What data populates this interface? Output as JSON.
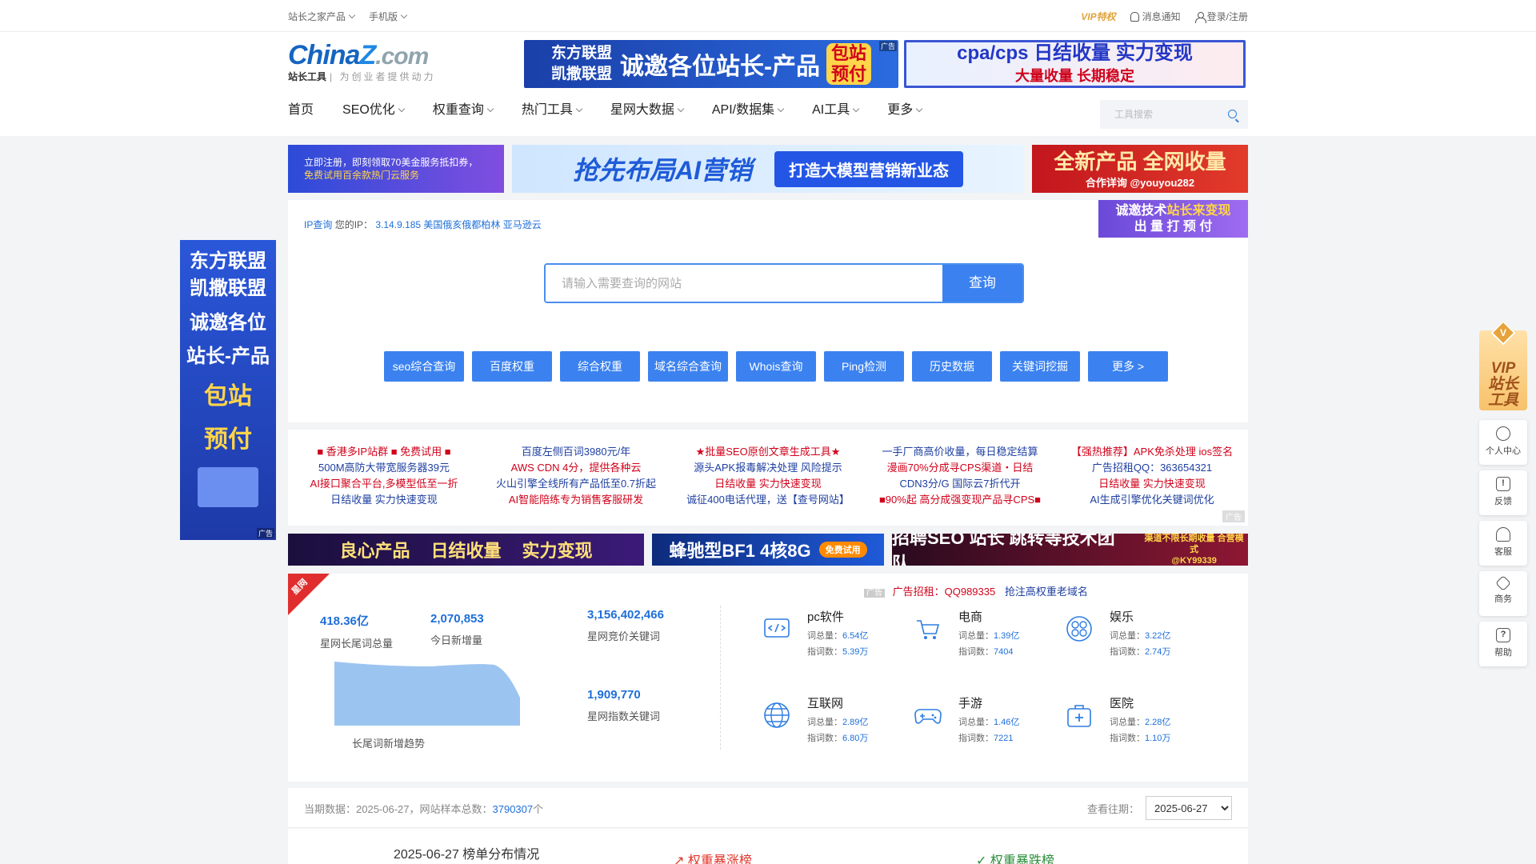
{
  "topbar": {
    "product_menu": "站长之家产品",
    "mobile": "手机版",
    "vip": "VIP特权",
    "notify": "消息通知",
    "login": "登录/注册"
  },
  "logo": {
    "brand_a": "China",
    "brand_z": "Z",
    "brand_com": ".com",
    "sub": "站长工具",
    "slogan": "| 为创业者提供动力"
  },
  "header_ads": {
    "ad1_small1": "东方联盟",
    "ad1_small2": "凯撒联盟",
    "ad1_big": "诚邀各位站长-产品",
    "ad1_tag1": "包站",
    "ad1_tag2": "预付",
    "ad2_l1": "cpa/cps 日结收量 实力变现",
    "ad2_l2": "大量收量 长期稳定",
    "ad_tag": "广告"
  },
  "nav": {
    "items": [
      "首页",
      "SEO优化",
      "权重查询",
      "热门工具",
      "星网大数据",
      "API/数据集",
      "AI工具",
      "更多"
    ],
    "search_placeholder": "工具搜索"
  },
  "banners2": {
    "a_l1": "立即注册，即刻领取70美金服务抵扣券，",
    "a_l2": "免费试用百余款热门云服务",
    "b_title": "抢先布局AI营销",
    "b_pill": "打造大模型营销新业态",
    "c_title": "全新产品 全网收量",
    "c_sub": "合作详询 @youyou282"
  },
  "ipinfo": {
    "label": "IP查询",
    "your_ip": "您的IP：",
    "value": "3.14.9.185 美国俄亥俄都柏林 亚马逊云"
  },
  "panel_ad": {
    "l1a": "诚邀技术",
    "l1b": "站长来变现",
    "l2": "出 量 打 预 付"
  },
  "main_search": {
    "placeholder": "请输入需要查询的网站",
    "button": "查询"
  },
  "quick_links": [
    "seo综合查询",
    "百度权重",
    "综合权重",
    "域名综合查询",
    "Whois查询",
    "Ping检测",
    "历史数据",
    "关键词挖掘",
    "更多 >"
  ],
  "text_ads": [
    [
      "■ 香港多IP站群 ■ 免费试用 ■",
      "500M高防大带宽服务器39元",
      "AI接口聚合平台,多模型低至一折",
      "日结收量 实力快速变现"
    ],
    [
      "百度左侧百词3980元/年",
      "AWS CDN 4分，提供各种云",
      "火山引擎全线所有产品低至0.7折起",
      "AI智能陪练专为销售客服研发"
    ],
    [
      "★批量SEO原创文章生成工具★",
      "源头APK报毒解决处理 风险提示",
      "日结收量 实力快速变现",
      "诚征400电话代理，送【查号网站】"
    ],
    [
      "一手厂商高价收量，每日稳定结算",
      "漫画70%分成寻CPS渠道・日结",
      "CDN3分/G 国际云7折代开",
      "■90%起 高分成强变现产品寻CPS■"
    ],
    [
      "【强热推荐】APK免杀处理 ios签名",
      "广告招租QQ：363654321",
      "日结收量 实力快速变现",
      "AI生成引擎优化关键词优化"
    ]
  ],
  "text_ads_tag": "广告",
  "banners3": {
    "a1": "良心产品",
    "a2": "日结收量",
    "a3": "实力变现",
    "b": "蜂驰型BF1 4核8G",
    "b_tag": "免费试用",
    "c": "招聘SEO 站长 跳转等技术团队",
    "c_small1": "渠道不限长期收量 合营模式",
    "c_small2": "@KY99339"
  },
  "stats": {
    "ribbon": "星网",
    "total_value": "418.36亿",
    "total_label": "星网长尾词总量",
    "today_value": "2,070,853",
    "today_label": "今日新增量",
    "bid_value": "3,156,402,466",
    "bid_label": "星网竞价关键词",
    "index_value": "1,909,770",
    "index_label": "星网指数关键词",
    "trend_label": "长尾词新增趋势",
    "ad_tag": "广告",
    "ad_text": "广告招租：QQ989335",
    "ad_link": "抢注高权重老域名"
  },
  "categories": [
    {
      "name": "pc软件",
      "total_k": "词总量：",
      "total": "6.54亿",
      "idx_k": "指词数：",
      "idx": "5.39万"
    },
    {
      "name": "电商",
      "total_k": "词总量：",
      "total": "1.39亿",
      "idx_k": "指词数：",
      "idx": "7404"
    },
    {
      "name": "娱乐",
      "total_k": "词总量：",
      "total": "3.22亿",
      "idx_k": "指词数：",
      "idx": "2.74万"
    },
    {
      "name": "互联网",
      "total_k": "词总量：",
      "total": "2.89亿",
      "idx_k": "指词数：",
      "idx": "6.80万"
    },
    {
      "name": "手游",
      "total_k": "词总量：",
      "total": "1.46亿",
      "idx_k": "指词数：",
      "idx": "7221"
    },
    {
      "name": "医院",
      "total_k": "词总量：",
      "total": "2.28亿",
      "idx_k": "指词数：",
      "idx": "1.10万"
    }
  ],
  "bottom": {
    "info_prefix": "当期数据：2025-06-27，网站样本总数：",
    "sample_count": "3790307",
    "unit": "个",
    "past_label": "查看往期：",
    "date": "2025-06-27",
    "dist_title": "2025-06-27 榜单分布情况",
    "rise": "权重暴涨榜",
    "fall": "权重暴跌榜"
  },
  "side_ad": {
    "l1": "东方联盟",
    "l2": "凯撒联盟",
    "l3": "诚邀各位",
    "l4": "站长-产品",
    "l5": "包站",
    "l6": "预付",
    "tag": "广告"
  },
  "right_tools": {
    "vip_badge": "V",
    "vip_l1": "VIP",
    "vip_l2": "站长",
    "vip_l3": "工具",
    "items": [
      "个人中心",
      "反馈",
      "客服",
      "商务",
      "帮助"
    ]
  },
  "colors": {
    "accent": "#3b82f0",
    "link": "#1e6fd9",
    "ad_red": "#d0021b",
    "rise": "#e0352b",
    "fall": "#2a8f3a"
  }
}
